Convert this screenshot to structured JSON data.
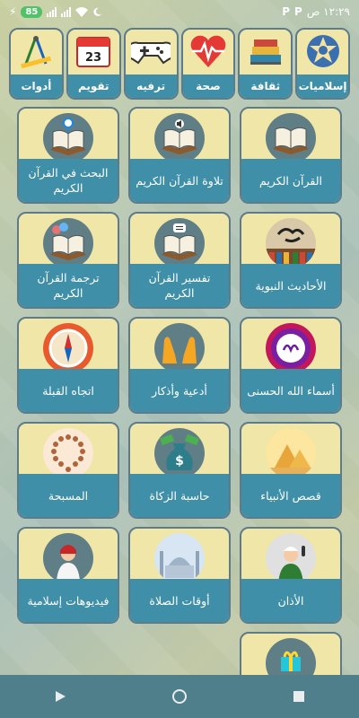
{
  "status": {
    "time": "١٢:٢٩ ص",
    "p1": "P",
    "p2": "P",
    "battery": "85"
  },
  "categories": [
    {
      "label": "إسلاميات",
      "icon": "islamic-pattern-icon"
    },
    {
      "label": "ثقافة",
      "icon": "books-icon"
    },
    {
      "label": "صحة",
      "icon": "heart-pulse-icon"
    },
    {
      "label": "ترفيه",
      "icon": "gamepad-icon"
    },
    {
      "label": "تقويم",
      "icon": "calendar-icon"
    },
    {
      "label": "أدوات",
      "icon": "compass-tools-icon"
    }
  ],
  "calendar_day": "23",
  "tiles": [
    {
      "label": "القرآن الكريم",
      "icon": "quran-icon"
    },
    {
      "label": "تلاوة القرآن الكريم",
      "icon": "quran-audio-icon"
    },
    {
      "label": "البحث في القرآن الكريم",
      "icon": "quran-search-icon"
    },
    {
      "label": "الأحاديث النبوية",
      "icon": "hadith-icon"
    },
    {
      "label": "تفسير القرآن الكريم",
      "icon": "tafsir-icon"
    },
    {
      "label": "ترجمة القرآن الكريم",
      "icon": "quran-translation-icon"
    },
    {
      "label": "أسماء الله الحسنى",
      "icon": "allah-names-icon"
    },
    {
      "label": "أدعية وأذكار",
      "icon": "praying-hands-icon"
    },
    {
      "label": "اتجاه القبلة",
      "icon": "qibla-compass-icon"
    },
    {
      "label": "قصص الأنبياء",
      "icon": "pyramids-icon"
    },
    {
      "label": "حاسبة الزكاة",
      "icon": "money-bag-icon"
    },
    {
      "label": "المسبحة",
      "icon": "prayer-beads-icon"
    },
    {
      "label": "الأذان",
      "icon": "muezzin-icon"
    },
    {
      "label": "أوقات الصلاة",
      "icon": "mosque-icon"
    },
    {
      "label": "فيديوهات إسلامية",
      "icon": "video-presenter-icon"
    },
    {
      "label": "",
      "icon": "gift-icon"
    }
  ],
  "nav": [
    "back-icon",
    "home-icon",
    "recents-icon"
  ],
  "colors": {
    "tile_bg": "#f0e6a8",
    "label_bg": "#3f8fa8",
    "border": "#5e7b8a",
    "navbar": "#4f7f8a"
  }
}
